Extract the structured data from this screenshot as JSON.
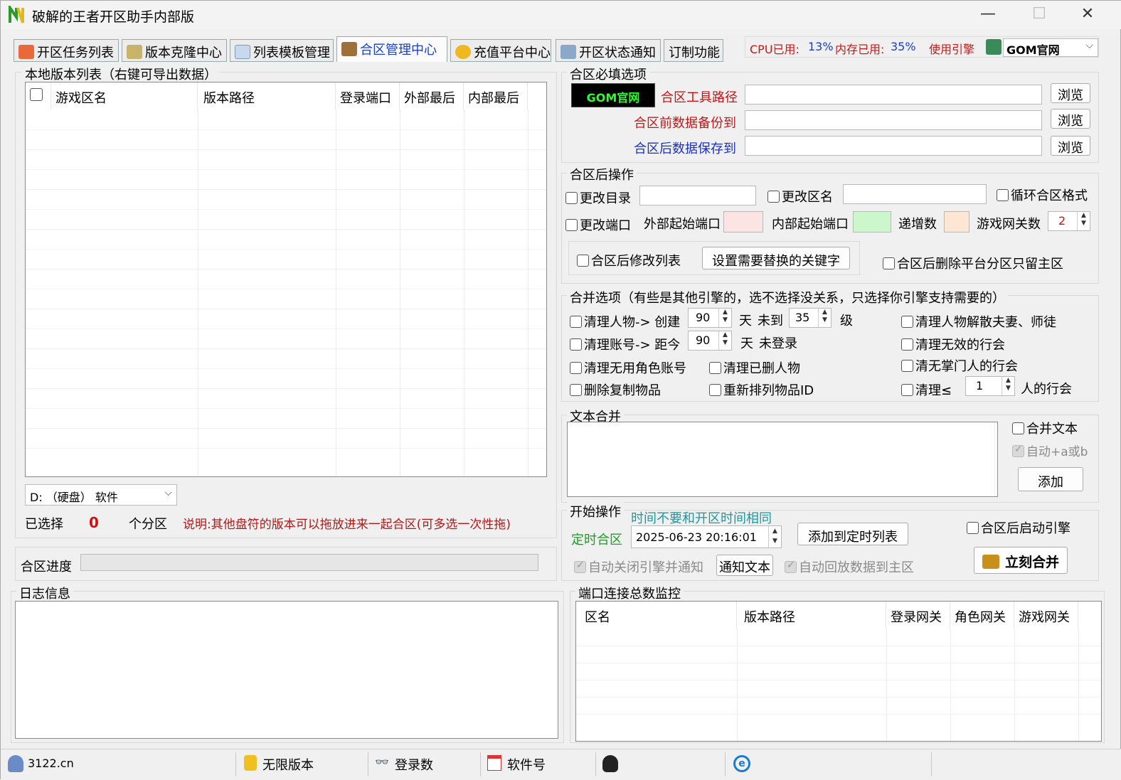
{
  "window": {
    "title": "破解的王者开区助手内部版"
  },
  "tabs": [
    {
      "label": "开区任务列表"
    },
    {
      "label": "版本克隆中心"
    },
    {
      "label": "列表模板管理"
    },
    {
      "label": "合区管理中心"
    },
    {
      "label": "充值平台中心"
    },
    {
      "label": "开区状态通知"
    },
    {
      "label": "订制功能"
    }
  ],
  "sysinfo": {
    "cpu_label": "CPU已用:",
    "cpu_value": "13%",
    "mem_label": "内存已用:",
    "mem_value": "35%",
    "engine_label": "使用引擎",
    "engine_value": "GOM官网"
  },
  "local_list": {
    "group_label": "本地版本列表（右键可导出数据）",
    "columns": [
      "游戏区名",
      "版本路径",
      "登录端口",
      "外部最后",
      "内部最后"
    ],
    "drive_select": "D: （硬盘） 软件",
    "selected_label": "已选择",
    "selected_count": "0",
    "partition_label": "个分区",
    "note": "说明:其他盘符的版本可以拖放进来一起合区(可多选一次性拖)"
  },
  "progress": {
    "label": "合区进度",
    "value": 0
  },
  "required": {
    "group_label": "合区必填选项",
    "engine_logo": "GOM官网",
    "tool_path_label": "合区工具路径",
    "backup_label": "合区前数据备份到",
    "save_label": "合区后数据保存到",
    "browse_label": "浏览"
  },
  "post": {
    "group_label": "合区后操作",
    "change_dir": "更改目录",
    "change_name": "更改区名",
    "loop_format": "循环合区格式",
    "change_port": "更改端口",
    "ext_port": "外部起始端口",
    "int_port": "内部起始端口",
    "increment": "递增数",
    "gateway_count_label": "游戏网关数",
    "gateway_count": "2",
    "modify_list": "合区后修改列表",
    "set_keywords": "设置需要替换的关键字",
    "delete_platform": "合区后删除平台分区只留主区"
  },
  "merge": {
    "group_label": "合并选项（有些是其他引擎的，选不选择没关系，只选择你引擎支持需要的）",
    "clean_char": "清理人物-> 创建",
    "clean_char_days": "90",
    "day_label": "天",
    "not_reach": "未到",
    "level_value": "35",
    "level_label": "级",
    "clean_marriage": "清理人物解散夫妻、师徒",
    "clean_account": "清理账号-> 距今",
    "account_days": "90",
    "not_login": "未登录",
    "clean_guild_invalid": "清理无效的行会",
    "clean_no_role": "清理无用角色账号",
    "clean_deleted": "清理已删人物",
    "clean_no_leader": "清无掌门人的行会",
    "delete_copies": "删除复制物品",
    "reorder_ids": "重新排列物品ID",
    "clean_le": "清理≤",
    "guild_min": "1",
    "guild_suffix": "人的行会"
  },
  "text_merge": {
    "group_label": "文本合并",
    "merge_text": "合并文本",
    "auto": "自动+a或b",
    "add": "添加"
  },
  "start": {
    "group_label": "开始操作",
    "hint": "时间不要和开区时间相同",
    "timed": "定时合区",
    "datetime": "2025-06-23 20:16:01",
    "add_timed": "添加到定时列表",
    "start_engine": "合区后启动引擎",
    "auto_close": "自动关闭引擎并通知",
    "notify_text": "通知文本",
    "auto_return": "自动回放数据到主区",
    "merge_now": "立刻合并"
  },
  "log": {
    "group_label": "日志信息"
  },
  "ports": {
    "group_label": "端口连接总数监控",
    "columns": [
      "区名",
      "版本路径",
      "登录网关",
      "角色网关",
      "游戏网关"
    ]
  },
  "statusbar": {
    "site": "3122.cn",
    "unlimited": "无限版本",
    "logins": "登录数",
    "software": "软件号"
  },
  "colors": {
    "ext_port": "#fde4e4",
    "int_port": "#ccf7cc",
    "increment": "#fde7d4",
    "accent_blue": "#1a40c8",
    "red": "#d01010"
  }
}
